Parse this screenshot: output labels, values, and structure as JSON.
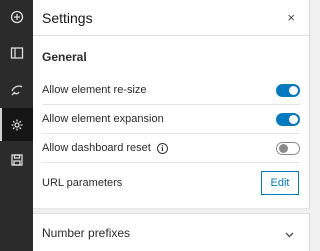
{
  "rail": {
    "items": [
      {
        "icon": "add-circle-icon"
      },
      {
        "icon": "layout-icon"
      },
      {
        "icon": "brush-icon"
      },
      {
        "icon": "gear-icon",
        "active": true
      },
      {
        "icon": "save-icon"
      }
    ]
  },
  "settings": {
    "title": "Settings",
    "close_glyph": "×",
    "general": {
      "title": "General",
      "rows": [
        {
          "label": "Allow element re-size",
          "enabled": true
        },
        {
          "label": "Allow element expansion",
          "enabled": true
        },
        {
          "label": "Allow dashboard reset",
          "enabled": false,
          "info_glyph": "i"
        }
      ],
      "url_parameters": {
        "label": "URL parameters",
        "button": "Edit"
      }
    },
    "number_prefixes": {
      "label": "Number prefixes"
    }
  },
  "colors": {
    "accent": "#0079c1",
    "rail": "#2b2b2b"
  }
}
